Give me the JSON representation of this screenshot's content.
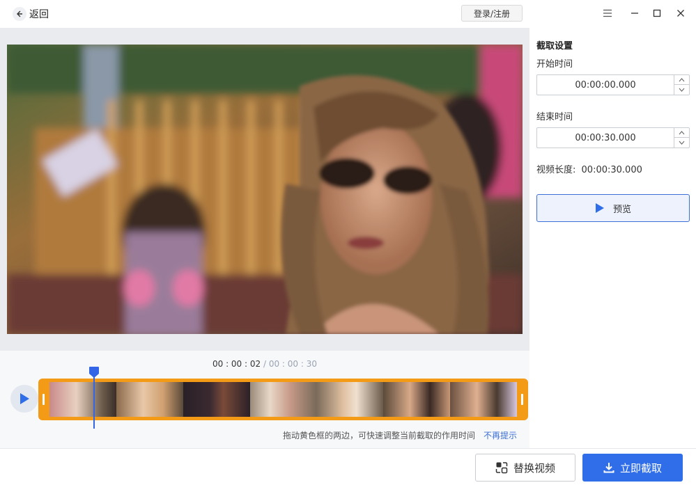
{
  "titlebar": {
    "back_label": "返回",
    "login_label": "登录/注册"
  },
  "icons": {
    "back": "arrow-left-icon",
    "menu": "menu-icon",
    "minimize": "minimize-icon",
    "maximize": "maximize-icon",
    "close": "close-icon",
    "play": "play-icon",
    "replace": "replace-icon",
    "download": "download-icon"
  },
  "timeline": {
    "current": "00 : 00 : 02",
    "separator": "/",
    "total": "00 : 00 : 30",
    "hint": "拖动黄色框的两边，可快速调整当前截取的作用时间",
    "hint_link": "不再提示"
  },
  "panel": {
    "title": "截取设置",
    "start_label": "开始时间",
    "start_value": "00:00:00.000",
    "end_label": "结束时间",
    "end_value": "00:00:30.000",
    "duration_label": "视频长度:",
    "duration_value": "00:00:30.000",
    "preview_label": "预览"
  },
  "footer": {
    "replace_label": "替换视频",
    "capture_label": "立即截取"
  },
  "colors": {
    "accent": "#2f6ee8",
    "strip": "#f39a17",
    "playhead": "#3366e6"
  }
}
